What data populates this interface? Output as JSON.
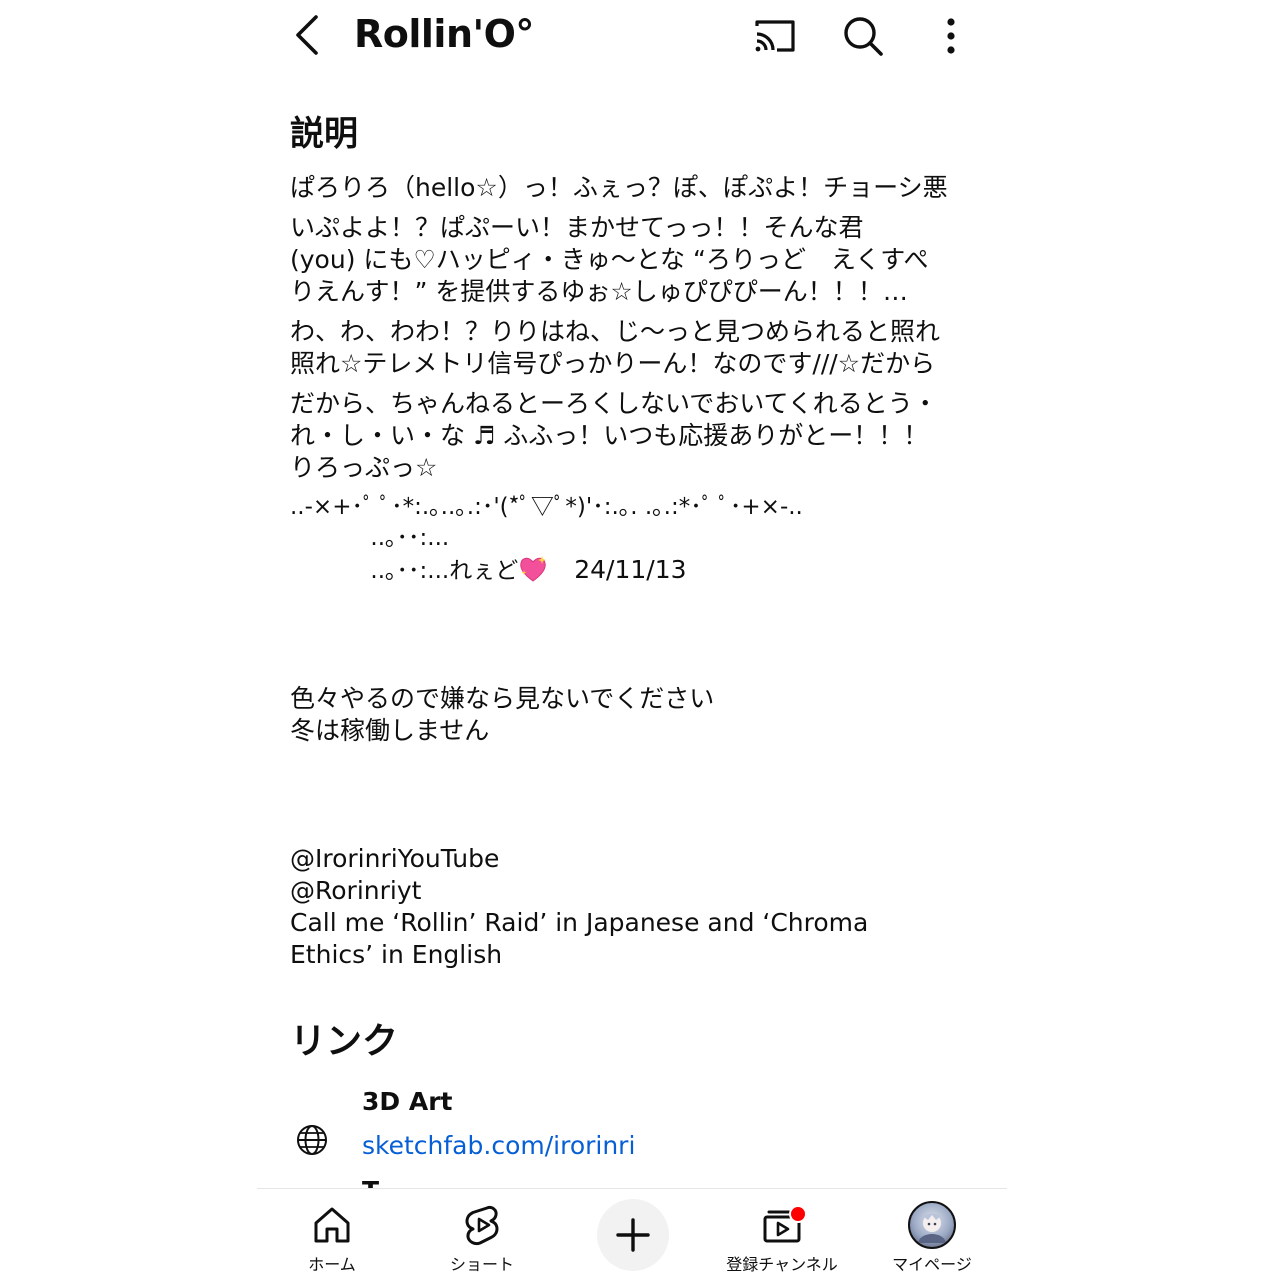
{
  "header": {
    "title": "Rollin'O°",
    "back_icon": "back-chevron-icon",
    "cast_icon": "cast-icon",
    "search_icon": "search-icon",
    "more_icon": "more-vert-icon"
  },
  "description": {
    "heading": "説明",
    "para1": "ぱろりろ（hello☆）っ！ふぇっ？ぽ、ぽぷよ！チョーシ悪",
    "para2": "いぷよよ！？ぱぷーい！まかせてっっ！！そんな君\n(you) にも♡ハッピィ・きゅ〜とな “ろりっど　えくすぺ\nりえんす！” を提供するゆぉ☆しゅぴぴぴーん！！！…",
    "para3": "わ、わ、わわ！？りりはね、じ〜っと見つめられると照れ\n照れ☆テレメトリ信号ぴっかりーん！なのです///☆だから",
    "para4": "だから、ちゃんねるとーろくしないでおいてくれるとう・\nれ・し・い・な ♬ ふふっ！いつも応援ありがとー！！！\nりろっぷっ☆",
    "kaomoji": "..-×+･ﾟ ﾟ･*:.｡..｡.:･'(*ﾟ▽ﾟ*)'･:.｡. .｡.:*･ﾟ ﾟ･+×-..",
    "sig_line1": "           ..｡･･:...",
    "sig_line2": "           ..｡･･:...れぇど",
    "date": "24/11/13",
    "note1": "色々やるので嫌なら見ないでください",
    "note2": "冬は稼働しません",
    "handle1": "@IrorinriYouTube",
    "handle2": "@Rorinriyt",
    "callme1": "Call me ‘Rollin’ Raid’ in Japanese and ‘Chroma",
    "callme2": "Ethics’ in English"
  },
  "links": {
    "heading": "リンク",
    "items": [
      {
        "name": "3D Art",
        "url": "sketchfab.com/irorinri",
        "icon": "globe-icon"
      }
    ],
    "next_peek": "T"
  },
  "bottom_nav": {
    "items": [
      {
        "label": "ホーム",
        "icon": "home-icon"
      },
      {
        "label": "ショート",
        "icon": "shorts-icon"
      },
      {
        "label": "",
        "icon": "create-plus-icon"
      },
      {
        "label": "登録チャンネル",
        "icon": "subscriptions-icon"
      },
      {
        "label": "マイページ",
        "icon": "avatar"
      }
    ]
  },
  "colors": {
    "link": "#065fd4",
    "badge": "#ff0000",
    "text": "#0f0f0f"
  }
}
